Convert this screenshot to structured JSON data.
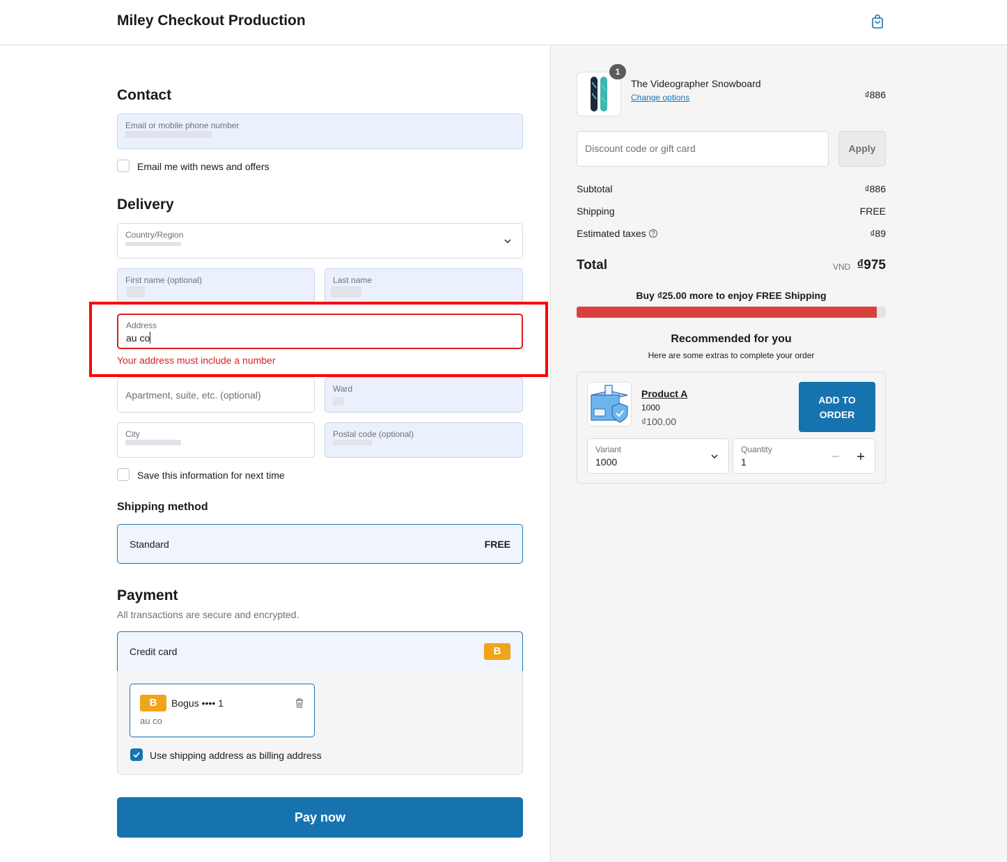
{
  "header": {
    "shop_title": "Miley Checkout Production"
  },
  "contact": {
    "title": "Contact",
    "email_label": "Email or mobile phone number",
    "newsletter_label": "Email me with news and offers"
  },
  "delivery": {
    "title": "Delivery",
    "country_label": "Country/Region",
    "first_name_label": "First name (optional)",
    "last_name_label": "Last name",
    "address_label": "Address",
    "address_value": "au co",
    "address_error": "Your address must include a number",
    "apartment_placeholder": "Apartment, suite, etc. (optional)",
    "ward_label": "Ward",
    "city_label": "City",
    "postal_label": "Postal code (optional)",
    "save_info_label": "Save this information for next time"
  },
  "shipping_method": {
    "title": "Shipping method",
    "option_name": "Standard",
    "option_price": "FREE"
  },
  "payment": {
    "title": "Payment",
    "subtitle": "All transactions are secure and encrypted.",
    "method_label": "Credit card",
    "badge_letter": "B",
    "saved_card": "Bogus •••• 1",
    "saved_card_address": "au co",
    "billing_same_label": "Use shipping address as billing address",
    "pay_button": "Pay now"
  },
  "summary": {
    "product_name": "The Videographer Snowboard",
    "change_options": "Change options",
    "product_price": "₫886",
    "quantity": "1",
    "discount_placeholder": "Discount code or gift card",
    "apply_button": "Apply",
    "subtotal_label": "Subtotal",
    "subtotal_value": "₫886",
    "shipping_label": "Shipping",
    "shipping_value": "FREE",
    "taxes_label": "Estimated taxes",
    "taxes_value": "₫89",
    "total_label": "Total",
    "total_currency": "VND",
    "total_value": "₫975",
    "free_shipping_msg": "Buy ₫25.00 more to enjoy FREE Shipping",
    "free_shipping_progress": 0.97
  },
  "recommendations": {
    "title": "Recommended for you",
    "subtitle": "Here are some extras to complete your order",
    "product_name": "Product A",
    "product_variant": "1000",
    "product_price": "₫100.00",
    "add_button_line1": "ADD TO",
    "add_button_line2": "ORDER",
    "variant_label": "Variant",
    "variant_value": "1000",
    "quantity_label": "Quantity",
    "quantity_value": "1"
  },
  "colors": {
    "accent": "#1773b0",
    "error": "#dd1d1d",
    "progress": "#d94141",
    "badge": "#f0a41c"
  }
}
